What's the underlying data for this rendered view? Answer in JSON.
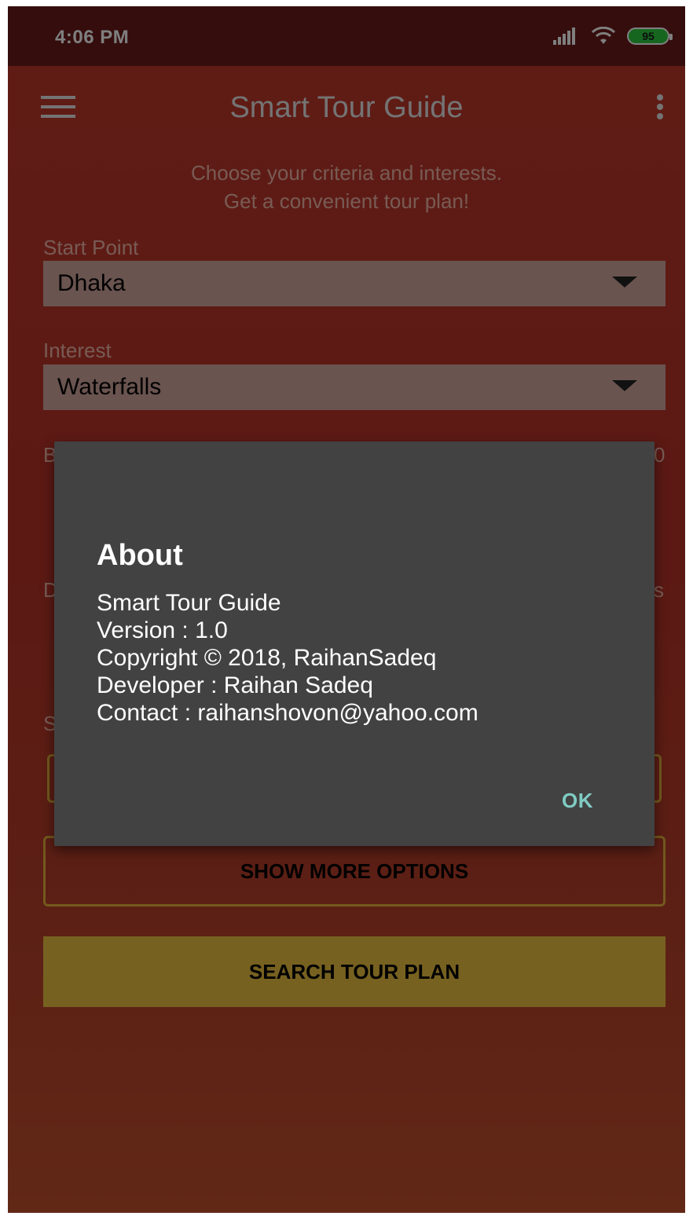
{
  "status_bar": {
    "time": "4:06 PM",
    "battery_level": "95",
    "signal_icon": "signal-icon",
    "wifi_icon": "wifi-icon"
  },
  "toolbar": {
    "menu_icon": "menu-icon",
    "title": "Smart Tour Guide",
    "overflow_icon": "more-vert-icon"
  },
  "form": {
    "subtitle_line1": "Choose your criteria and interests.",
    "subtitle_line2": "Get a convenient tour plan!",
    "start_point": {
      "label": "Start Point",
      "value": "Dhaka"
    },
    "interest": {
      "label": "Interest",
      "value": "Waterfalls"
    },
    "peek_labels": {
      "b_left": "B",
      "b_right": "0",
      "d_left": "D",
      "d_right": "s",
      "s_left": "S"
    },
    "show_more_options_label": "SHOW MORE OPTIONS",
    "search_tour_plan_label": "SEARCH TOUR PLAN"
  },
  "dialog": {
    "title": "About",
    "lines": [
      "Smart Tour Guide",
      "Version : 1.0",
      "Copyright © 2018, RaihanSadeq",
      "Developer : Raihan Sadeq",
      "Contact : raihanshovon@yahoo.com"
    ],
    "ok_label": "OK"
  },
  "colors": {
    "primary": "#c0392b",
    "status_bar": "#6b1a1a",
    "accent": "#efc341",
    "dialog_bg": "#424242",
    "dialog_button": "#80cbc4"
  }
}
